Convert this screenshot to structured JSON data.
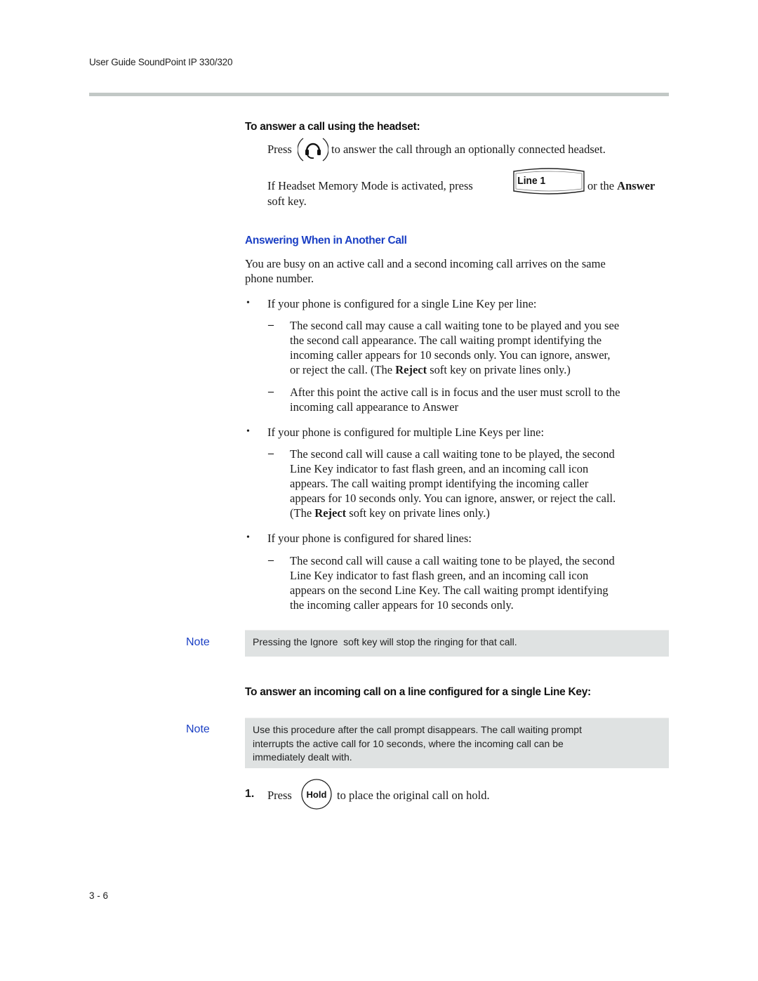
{
  "header": {
    "running_title": "User Guide SoundPoint IP 330/320"
  },
  "headset_procedure": {
    "heading": "To answer a call using the headset:",
    "press_label": "Press",
    "press_rest": "to answer the call through an optionally connected headset.",
    "memory_mode_before": "If Headset Memory Mode is activated, press",
    "memory_mode_after": "or the",
    "answer_key": "Answer",
    "soft_key_tail": "soft key.",
    "line_key_label": "Line 1"
  },
  "section": {
    "title": "Answering When in Another Call",
    "intro_line1": "You are busy on an active call and a second incoming call arrives on the same",
    "intro_line2": "phone number.",
    "bullets": [
      {
        "text": "If your phone is configured for a single Line Key per line:",
        "subitems": [
          {
            "lines": [
              "The second call may cause a call waiting tone to be played and you see",
              "the second call appearance. The call waiting prompt identifying the",
              "incoming caller appears for 10 seconds only. You can ignore, answer,"
            ],
            "last_pre": "or reject the call. (The ",
            "last_bold": "Reject",
            "last_post": " soft key on private lines only.)"
          },
          {
            "lines": [
              "After this point the active call is in focus and the user must scroll to the",
              "incoming call appearance to Answer"
            ]
          }
        ]
      },
      {
        "text": "If your phone is configured for multiple Line Keys per line:",
        "subitems": [
          {
            "lines": [
              "The second call will cause a call waiting tone to be played, the second",
              "Line Key indicator to fast flash green, and an incoming call icon",
              "appears. The call waiting prompt identifying the incoming caller",
              "appears for 10 seconds only. You can ignore, answer, or reject the call."
            ],
            "last_pre": "(The ",
            "last_bold": "Reject",
            "last_post": " soft key on private lines only.)"
          }
        ]
      },
      {
        "text": "If your phone is configured for shared lines:",
        "subitems": [
          {
            "lines": [
              "The second call will cause a call waiting tone to be played, the second",
              "Line Key indicator to fast flash green, and an incoming call icon",
              "appears on the second Line Key. The call waiting prompt identifying",
              "the incoming caller appears for 10 seconds only."
            ]
          }
        ]
      }
    ]
  },
  "notes": [
    {
      "label": "Note",
      "lines": [
        "Pressing the Ignore  soft key will stop the ringing for that call."
      ]
    },
    {
      "label": "Note",
      "lines": [
        "Use this procedure after the call prompt disappears. The call waiting prompt",
        "interrupts the active call for 10 seconds, where the incoming call can be",
        "immediately dealt with."
      ]
    }
  ],
  "single_line_procedure": {
    "heading": "To answer an incoming call on a line configured for a single Line Key:",
    "steps": [
      {
        "number": "1.",
        "pre": "Press",
        "key_label": "Hold",
        "post": "to place the original call on hold."
      }
    ]
  },
  "footer": {
    "page_number": "3 - 6"
  },
  "colors": {
    "heading_blue": "#1a3fc4",
    "note_label_blue": "#1a3fc4",
    "note_background": "#dfe2e2",
    "header_rule": "#c2c8c6"
  }
}
